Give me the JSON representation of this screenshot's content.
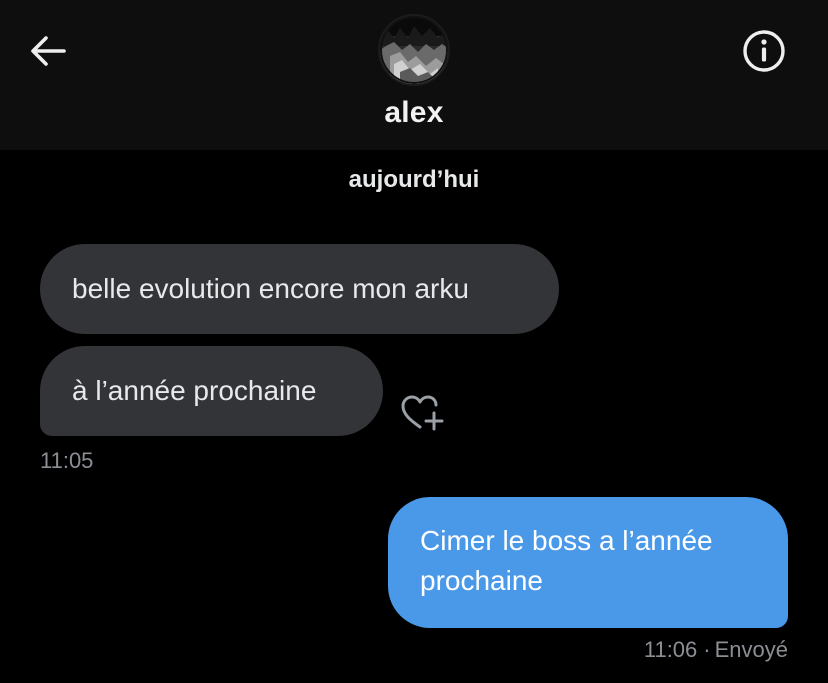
{
  "header": {
    "contact_name": "alex",
    "avatar_alt": "profile picture",
    "back_icon": "arrow-left-icon",
    "info_icon": "info-circle-icon"
  },
  "conversation": {
    "day_separator": "aujourd’hui",
    "incoming": [
      {
        "text": "belle evolution encore mon arku"
      },
      {
        "text": "à l’année prochaine"
      }
    ],
    "incoming_time": "11:05",
    "reaction_icon": "heart-plus-icon",
    "outgoing": [
      {
        "text": "Cimer le boss a l’année prochaine"
      }
    ],
    "outgoing_time": "11:06",
    "separator": "·",
    "outgoing_status": "Envoyé"
  },
  "colors": {
    "background": "#000000",
    "header_background": "#0e0e0f",
    "incoming_bubble": "#333438",
    "outgoing_bubble": "#4a99e9",
    "muted_text": "#8b8f95"
  }
}
